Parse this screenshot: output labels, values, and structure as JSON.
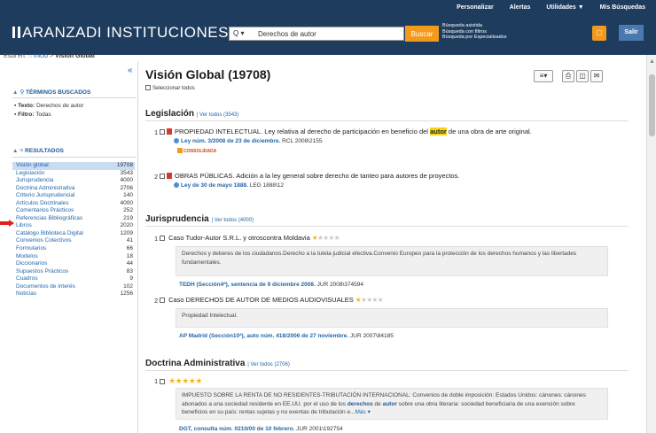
{
  "header": {
    "brand": "ARANZADI INSTITUCIONES",
    "toplinks": [
      "Personalizar",
      "Alertas",
      "Utilidades ▼",
      "Mis Búsquedas"
    ],
    "search_scope": "Q ▾",
    "search_value": "Derechos de autor",
    "search_button": "Buscar",
    "advanced": [
      "Búsqueda asistida",
      "Búsqueda con filtros",
      "Búsqueda por Especializados"
    ],
    "logout": "Salir",
    "cart_icon": "shopping-bag-icon",
    "brand_color": "#1d3c5e",
    "accent_color": "#f39a1e"
  },
  "breadcrumb": {
    "prefix": "Está en:",
    "home": "Inicio",
    "sep": ">",
    "current": "Visión Global"
  },
  "sidebar": {
    "terms_title": "TÉRMINOS BUSCADOS",
    "text_label": "Texto:",
    "text_value": "Derechos de autor",
    "filter_label": "Filtro:",
    "filter_value": "Todas",
    "results_title": "RESULTADOS",
    "results": [
      {
        "label": "Visión global",
        "count": "19708"
      },
      {
        "label": "Legislación",
        "count": "3543"
      },
      {
        "label": "Jurisprudencia",
        "count": "4000"
      },
      {
        "label": "Doctrina Administrativa",
        "count": "2706"
      },
      {
        "label": "Criterio Jurisprudencial",
        "count": "140"
      },
      {
        "label": "Artículos Doctrinales",
        "count": "4000"
      },
      {
        "label": "Comentarios Prácticos",
        "count": "252"
      },
      {
        "label": "Referencias Bibliográficas",
        "count": "219"
      },
      {
        "label": "Libros",
        "count": "2020"
      },
      {
        "label": "Catálogo Biblioteca Digital",
        "count": "1209"
      },
      {
        "label": "Convenios Colectivos",
        "count": "41"
      },
      {
        "label": "Formularios",
        "count": "66"
      },
      {
        "label": "Modelos",
        "count": "18"
      },
      {
        "label": "Diccionarios",
        "count": "44"
      },
      {
        "label": "Supuestos Prácticos",
        "count": "83"
      },
      {
        "label": "Cuadros",
        "count": "9"
      },
      {
        "label": "Documentos de interés",
        "count": "102"
      },
      {
        "label": "Noticias",
        "count": "1256"
      }
    ]
  },
  "main": {
    "title": "Visión Global (19708)",
    "select_all": "Seleccionar todos",
    "legislacion": {
      "title": "Legislación",
      "view_all": "Ver todos (3543)",
      "items": [
        {
          "num": "1",
          "pre": "PROPIEDAD INTELECTUAL. Ley relativa al derecho de participación en beneficio del",
          "hl": "autor",
          "post": "de una obra de arte original.",
          "ref_link": "Ley núm. 3/2008 de 23 de diciembre.",
          "ref": "RCL 2008\\2155",
          "badge": "CONSOLIDADA"
        },
        {
          "num": "2",
          "text": "OBRAS PÚBLICAS. Adición a la ley general sobre derecho de tanteo para autores de proyectos.",
          "ref_link": "Ley de 30 de mayo 1888.",
          "ref": "LEG 1888\\12"
        }
      ]
    },
    "jurisprudencia": {
      "title": "Jurisprudencia",
      "view_all": "Ver todos (4000)",
      "items": [
        {
          "num": "1",
          "text": "Caso Tudor-Autor S.R.L. y otroscontra Moldavia",
          "stars": 1,
          "summary": "Derechos y deberes de los ciudadanos.Derecho a la tutela judicial efectiva.Convenio Europeo para la protección de los derechos humanos y las libertades fundamentales.",
          "ref_link": "TEDH (Sección4ª), sentencia de 9 diciembre 2008.",
          "ref": "JUR 2008\\374594"
        },
        {
          "num": "2",
          "text": "Caso DERECHOS DE AUTOR DE MEDIOS AUDIOVISUALES",
          "stars": 1,
          "summary": "Propiedad Intelectual.",
          "ref_link": "AP Madrid (Sección10ª), auto núm. 418/2006 de 27 noviembre.",
          "ref": "JUR 2007\\84185"
        }
      ]
    },
    "doctrina": {
      "title": "Doctrina Administrativa",
      "view_all": "Ver todos (2706)",
      "items": [
        {
          "num": "1",
          "stars": 5,
          "summary_a": "IMPUESTO SOBRE LA RENTA DE NO RESIDENTES-TRIBUTACIÓN INTERNACIONAL: Convenios de doble imposición: Estados Unidos: cánones: cánones abonados a una sociedad residente en EE.UU. por el uso de los",
          "hl1": "derechos",
          "mid": "de",
          "hl2": "autor",
          "summary_b": "sobre una obra literaria: sociedad beneficiaria de una exención sobre beneficios en su país: rentas sujetas y no exentas de tributación e...",
          "more": "Más ▾",
          "ref_link": "DGT, consulta núm. 0210/00 de 10 febrero.",
          "ref": "JUR 2001\\192754"
        }
      ]
    }
  }
}
